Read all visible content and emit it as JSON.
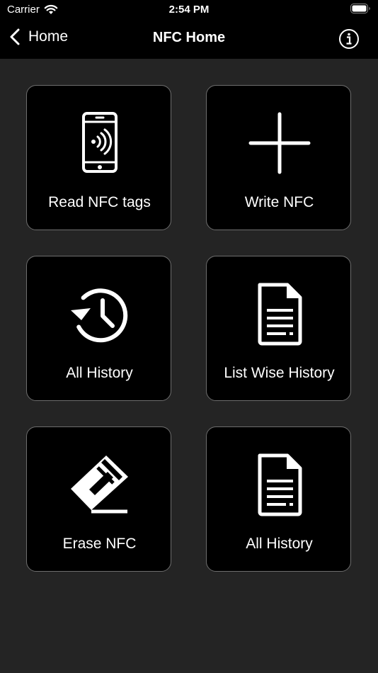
{
  "status": {
    "carrier": "Carrier",
    "time": "2:54 PM"
  },
  "nav": {
    "back_label": "Home",
    "title": "NFC Home"
  },
  "tiles": [
    {
      "label": "Read NFC tags",
      "icon": "phone-nfc-icon"
    },
    {
      "label": "Write NFC",
      "icon": "plus-icon"
    },
    {
      "label": "All History",
      "icon": "history-icon"
    },
    {
      "label": "List Wise History",
      "icon": "document-icon"
    },
    {
      "label": "Erase NFC",
      "icon": "eraser-icon"
    },
    {
      "label": "All History",
      "icon": "document-icon"
    }
  ],
  "colors": {
    "background": "#242424",
    "topbar": "#000000",
    "tile": "#000000",
    "tile_border": "#6e6e6e",
    "text": "#ffffff"
  }
}
